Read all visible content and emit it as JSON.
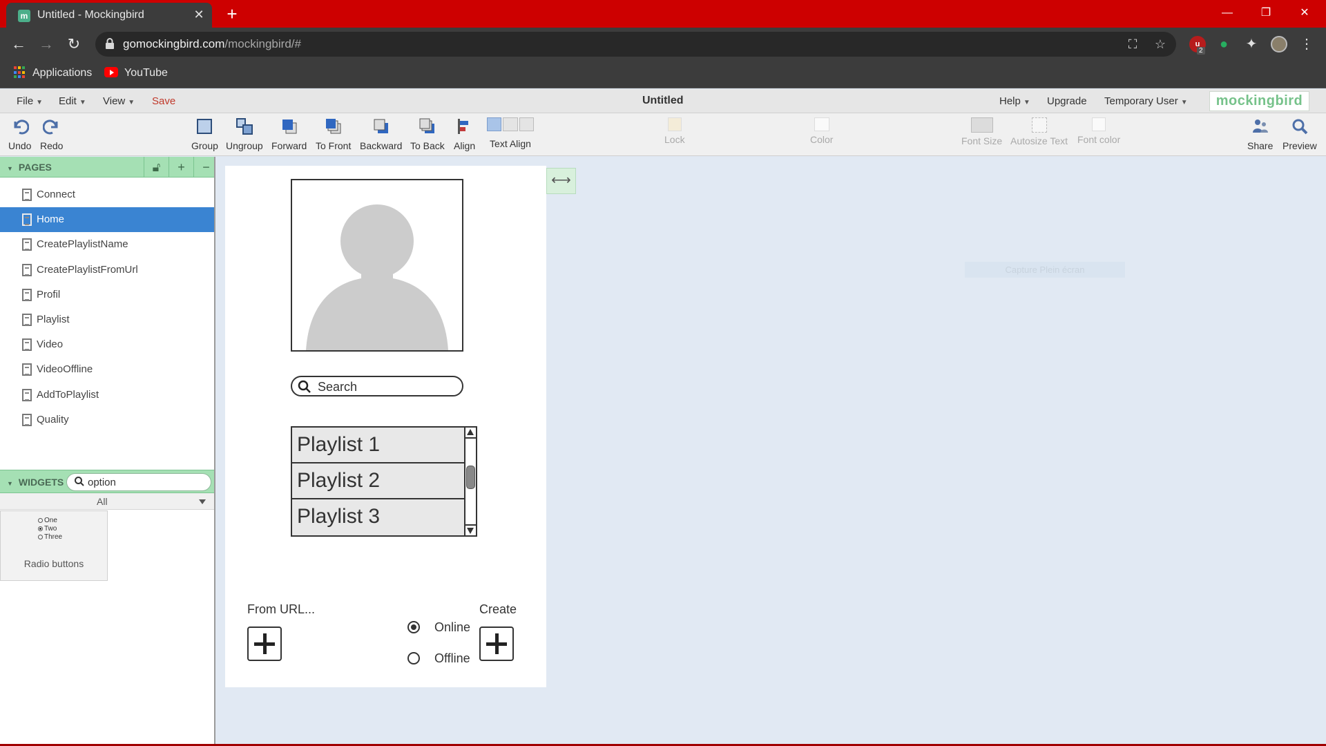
{
  "browser": {
    "tab_title": "Untitled - Mockingbird",
    "tab_favicon": "m",
    "url_host": "gomockingbird.com",
    "url_path": "/mockingbird/#",
    "extension_badge": "2",
    "bookmarks": [
      {
        "label": "Applications",
        "icon": "apps-grid-icon"
      },
      {
        "label": "YouTube",
        "icon": "youtube-icon"
      }
    ],
    "colors": {
      "tabbar": "#cd0000",
      "toolbar": "#3c3c3c"
    }
  },
  "menu": {
    "file": "File",
    "edit": "Edit",
    "view": "View",
    "save": "Save",
    "document_title": "Untitled",
    "help": "Help",
    "upgrade": "Upgrade",
    "user": "Temporary User",
    "logo": "mockingbird"
  },
  "toolbar": {
    "undo": "Undo",
    "redo": "Redo",
    "group": "Group",
    "ungroup": "Ungroup",
    "forward": "Forward",
    "to_front": "To Front",
    "backward": "Backward",
    "to_back": "To Back",
    "align": "Align",
    "text_align": "Text Align",
    "lock": "Lock",
    "color": "Color",
    "font_size": "Font Size",
    "autosize_text": "Autosize Text",
    "font_color": "Font color",
    "share": "Share",
    "preview": "Preview"
  },
  "pages": {
    "header": "PAGES",
    "items": [
      {
        "label": "Connect",
        "active": false
      },
      {
        "label": "Home",
        "active": true
      },
      {
        "label": "CreatePlaylistName",
        "active": false
      },
      {
        "label": "CreatePlaylistFromUrl",
        "active": false
      },
      {
        "label": "Profil",
        "active": false
      },
      {
        "label": "Playlist",
        "active": false
      },
      {
        "label": "Video",
        "active": false
      },
      {
        "label": "VideoOffline",
        "active": false
      },
      {
        "label": "AddToPlaylist",
        "active": false
      },
      {
        "label": "Quality",
        "active": false
      }
    ]
  },
  "widgets": {
    "header": "WIDGETS",
    "search_value": "option",
    "filter": "All",
    "card": {
      "options": [
        "One",
        "Two",
        "Three"
      ],
      "selected_index": 1,
      "label": "Radio buttons"
    }
  },
  "canvas": {
    "search_placeholder": "Search",
    "playlists": [
      "Playlist 1",
      "Playlist 2",
      "Playlist 3"
    ],
    "from_url_label": "From URL...",
    "create_label": "Create",
    "radio_online": "Online",
    "radio_offline": "Offline",
    "online_selected": true,
    "ghost_tooltip": "Capture Plein écran"
  }
}
